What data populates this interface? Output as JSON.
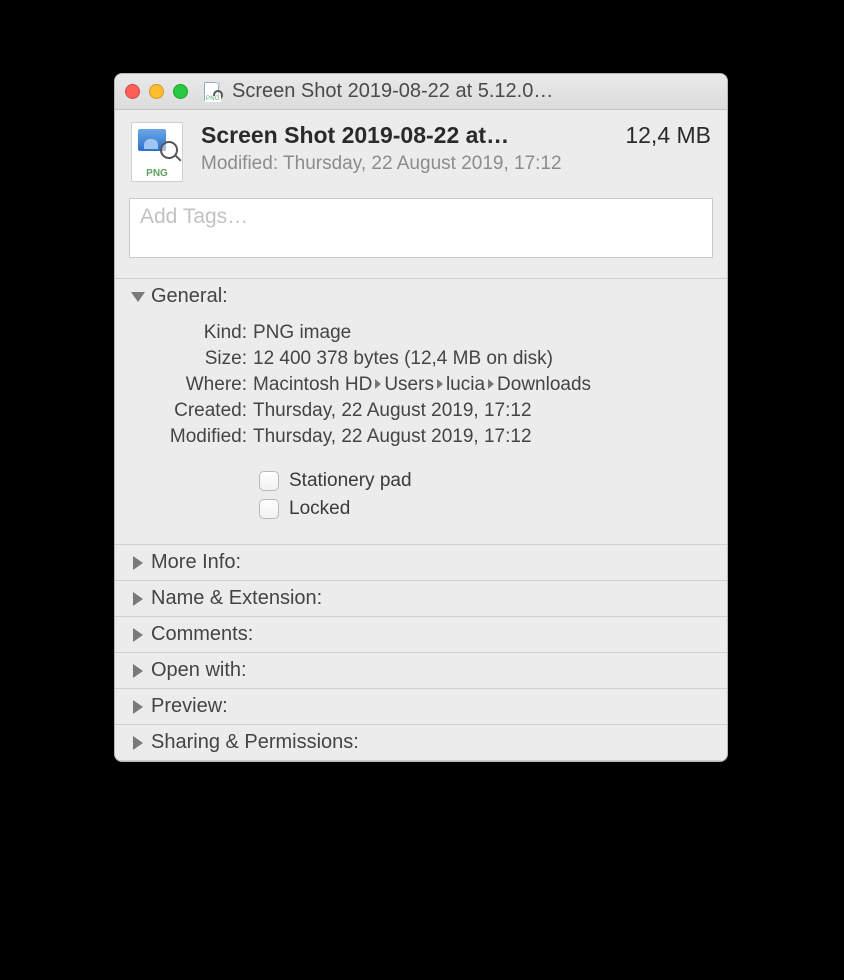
{
  "titlebar": {
    "title": "Screen Shot 2019-08-22 at 5.12.0…"
  },
  "file_icon_badge": "PNG",
  "header": {
    "filename": "Screen Shot 2019-08-22 at…",
    "size": "12,4 MB",
    "modified_label": "Modified:",
    "modified_value": "Thursday, 22 August 2019, 17:12"
  },
  "tags_placeholder": "Add Tags…",
  "general": {
    "title": "General:",
    "kind_label": "Kind:",
    "kind_value": "PNG image",
    "size_label": "Size:",
    "size_value": "12 400 378 bytes (12,4 MB on disk)",
    "where_label": "Where:",
    "where_parts": [
      "Macintosh HD",
      "Users",
      "lucia",
      "Downloads"
    ],
    "created_label": "Created:",
    "created_value": "Thursday, 22 August 2019, 17:12",
    "modified_label": "Modified:",
    "modified_value": "Thursday, 22 August 2019, 17:12",
    "stationery_label": "Stationery pad",
    "locked_label": "Locked"
  },
  "sections": {
    "more_info": "More Info:",
    "name_ext": "Name & Extension:",
    "comments": "Comments:",
    "open_with": "Open with:",
    "preview": "Preview:",
    "sharing": "Sharing & Permissions:"
  }
}
